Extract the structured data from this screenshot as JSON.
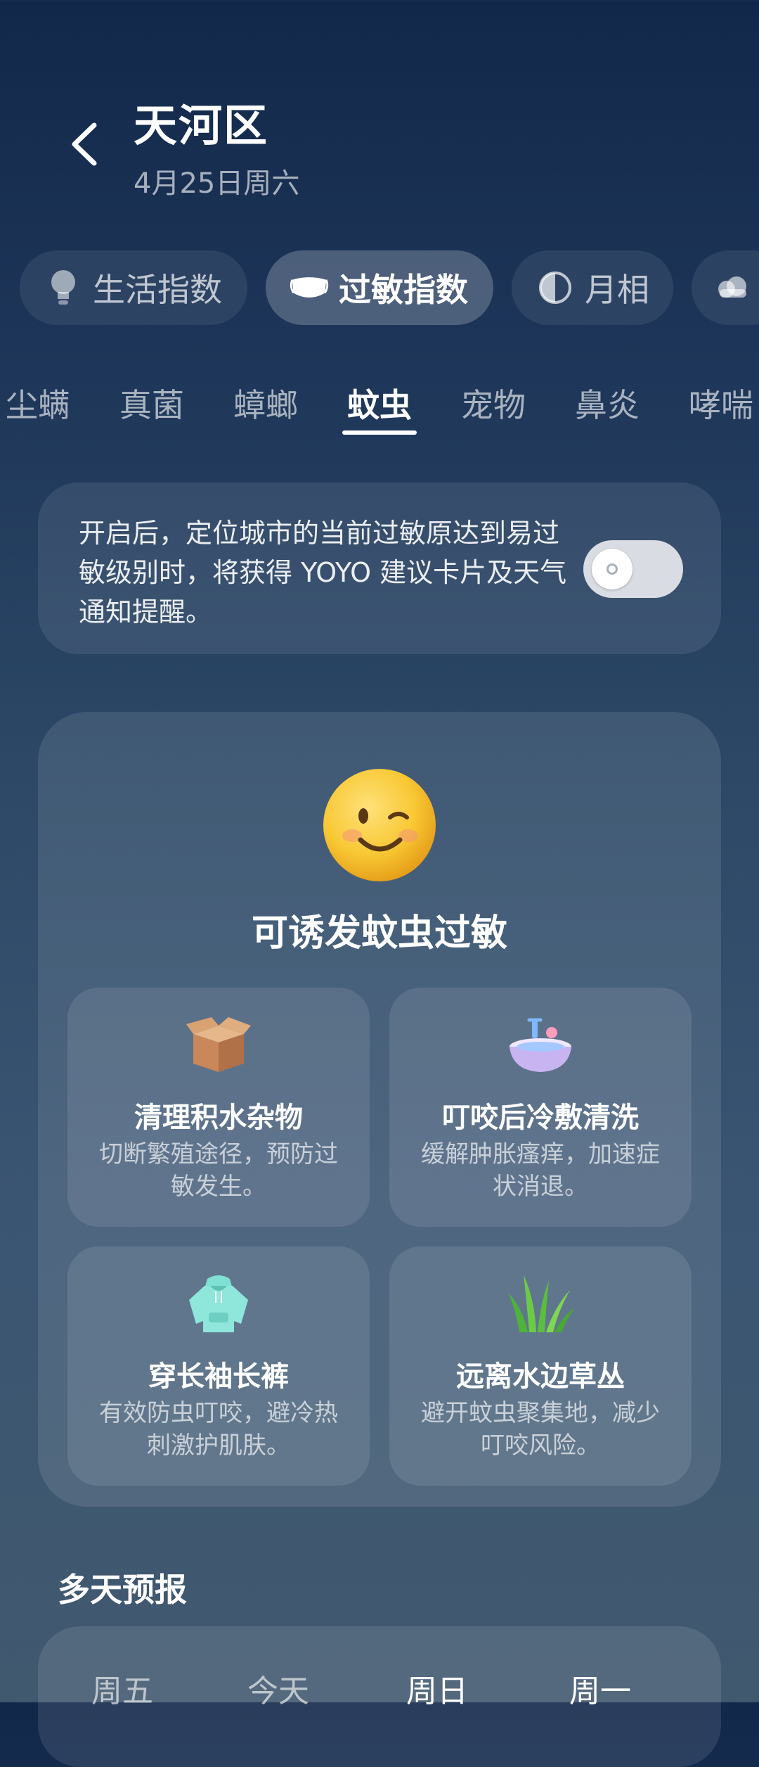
{
  "header": {
    "title": "天河区",
    "date": "4月25日周六"
  },
  "category_tabs": [
    {
      "label": "生活指数",
      "icon": "lightbulb-icon",
      "active": false
    },
    {
      "label": "过敏指数",
      "icon": "face-mask-icon",
      "active": true
    },
    {
      "label": "月相",
      "icon": "moon-phase-icon",
      "active": false
    },
    {
      "label": "",
      "icon": "cloud-icon",
      "active": false
    }
  ],
  "allergen_tabs": [
    "尘螨",
    "真菌",
    "蟑螂",
    "蚊虫",
    "宠物",
    "鼻炎",
    "哮喘"
  ],
  "active_allergen": "蚊虫",
  "notice": {
    "text": "开启后，定位城市的当前过敏原达到易过敏级别时，将获得 YOYO 建议卡片及天气通知提醒。",
    "toggle_on": false
  },
  "status": {
    "emoji": "winking-face-icon",
    "text": "可诱发蚊虫过敏"
  },
  "tips": [
    {
      "icon": "cardboard-box-icon",
      "title": "清理积水杂物",
      "desc": "切断繁殖途径，预防过敏发生。"
    },
    {
      "icon": "wash-basin-icon",
      "title": "叮咬后冷敷清洗",
      "desc": "缓解肿胀瘙痒，加速症状消退。"
    },
    {
      "icon": "hoodie-icon",
      "title": "穿长袖长裤",
      "desc": "有效防虫叮咬，避冷热刺激护肌肤。"
    },
    {
      "icon": "grass-icon",
      "title": "远离水边草丛",
      "desc": "避开蚊虫聚集地，减少叮咬风险。"
    }
  ],
  "forecast": {
    "title": "多天预报",
    "days": [
      "周五",
      "今天",
      "周日",
      "周一"
    ]
  },
  "colors": {
    "background_top": "#12284a",
    "background_bottom": "#41596f",
    "emoji_yellow": "#f6c12c"
  }
}
